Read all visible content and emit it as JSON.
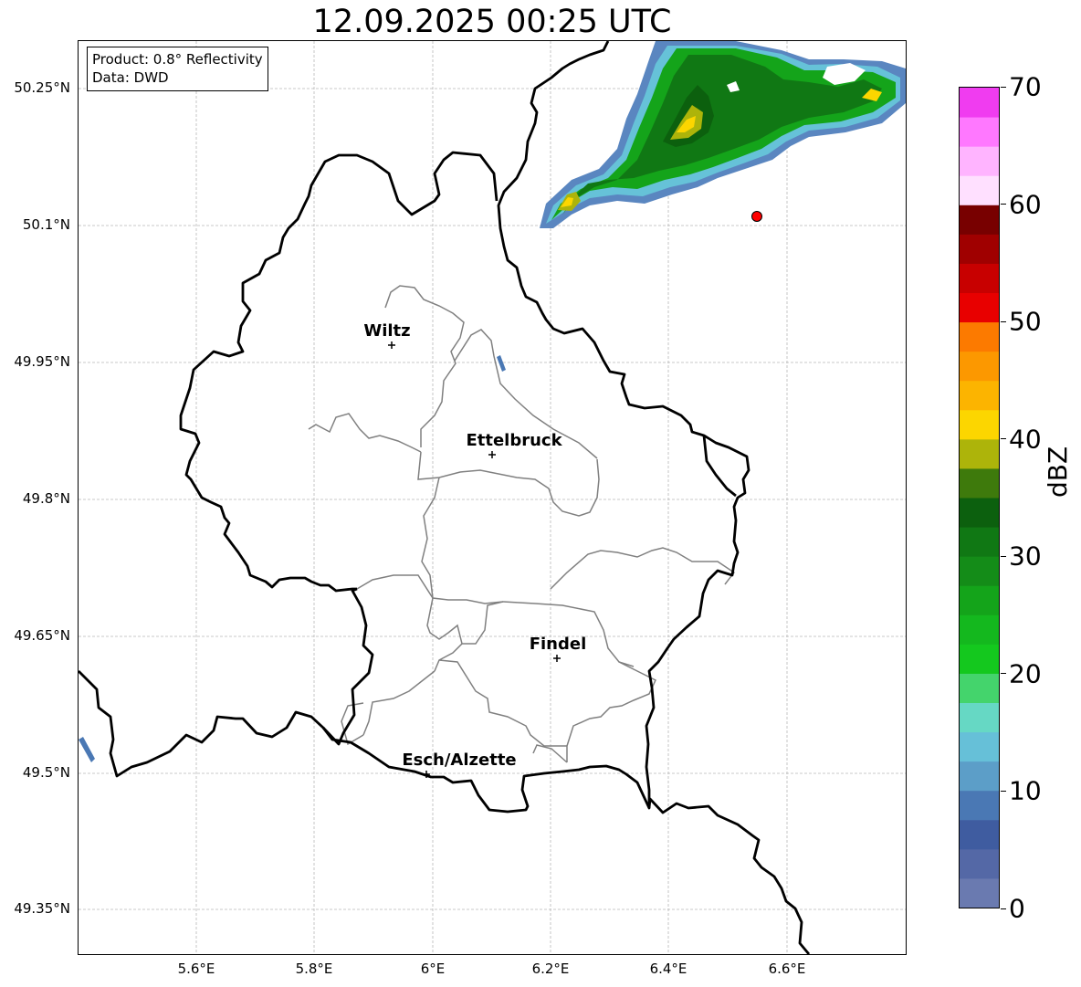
{
  "title": "12.09.2025 00:25 UTC",
  "info_box": {
    "product": "Product: 0.8° Reflectivity",
    "data_source": "Data: DWD"
  },
  "map": {
    "lat_labels": [
      "50.25°N",
      "50.1°N",
      "49.95°N",
      "49.8°N",
      "49.65°N",
      "49.5°N",
      "49.35°N"
    ],
    "lon_labels": [
      "5.6°E",
      "5.8°E",
      "6°E",
      "6.2°E",
      "6.4°E",
      "6.6°E"
    ],
    "cities": [
      {
        "name": "Wiltz"
      },
      {
        "name": "Ettelbruck"
      },
      {
        "name": "Findel"
      },
      {
        "name": "Esch/Alzette"
      }
    ],
    "marker_color": "#ff0000",
    "border_color": "#000000",
    "canton_color": "#808080"
  },
  "colorbar": {
    "unit": "dBZ",
    "tick_labels": [
      "0",
      "10",
      "20",
      "30",
      "40",
      "50",
      "60",
      "70"
    ],
    "min": 0,
    "max": 70,
    "step": 2.5,
    "colors": [
      "#6a7ab0",
      "#5468a6",
      "#3f5ca0",
      "#4a78b4",
      "#5c9ec8",
      "#66c0d8",
      "#66d8c4",
      "#44d46c",
      "#14c81e",
      "#14b81e",
      "#14a41a",
      "#148c18",
      "#107814",
      "#0c600e",
      "#3e7a0c",
      "#adb40a",
      "#fcd600",
      "#fcb400",
      "#fc9800",
      "#fc7a00",
      "#e80000",
      "#c80000",
      "#a00000",
      "#780000",
      "#ffe0ff",
      "#ffb4ff",
      "#ff78ff",
      "#f03cf0"
    ]
  }
}
